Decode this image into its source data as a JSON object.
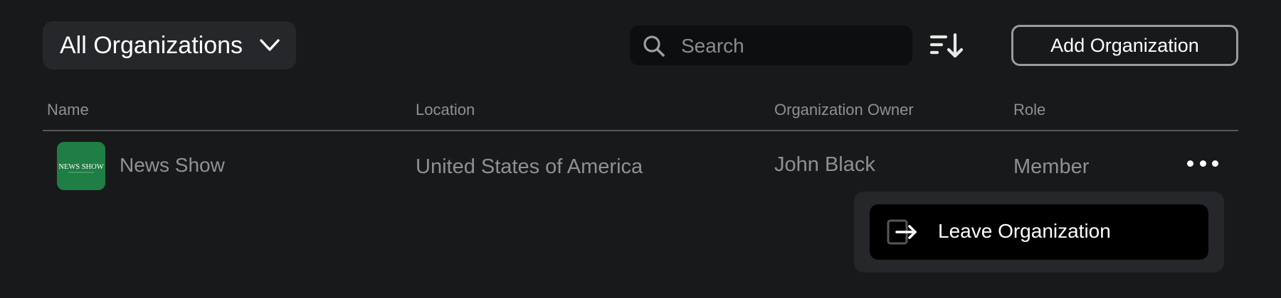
{
  "toolbar": {
    "org_filter": {
      "label": "All Organizations",
      "icon": "chevron-down-icon"
    },
    "search": {
      "placeholder": "Search",
      "value": "",
      "icon": "search-icon"
    },
    "sort_icon": "sort-descending-icon",
    "add_button_label": "Add Organization"
  },
  "table": {
    "columns": [
      "Name",
      "Location",
      "Organization Owner",
      "Role"
    ],
    "rows": [
      {
        "logo_text": "NEWS SHOW",
        "name": "News Show",
        "location": "United States of America",
        "owner": "John Black",
        "role": "Member",
        "actions_icon": "more-horizontal-icon"
      }
    ]
  },
  "context_menu": {
    "items": [
      {
        "label": "Leave Organization",
        "icon": "leave-icon"
      }
    ]
  },
  "colors": {
    "background": "#18191b",
    "surface": "#25272b",
    "search_bg": "#0d0e10",
    "logo_bg": "#1e7e43",
    "muted_text": "#8e9094"
  }
}
